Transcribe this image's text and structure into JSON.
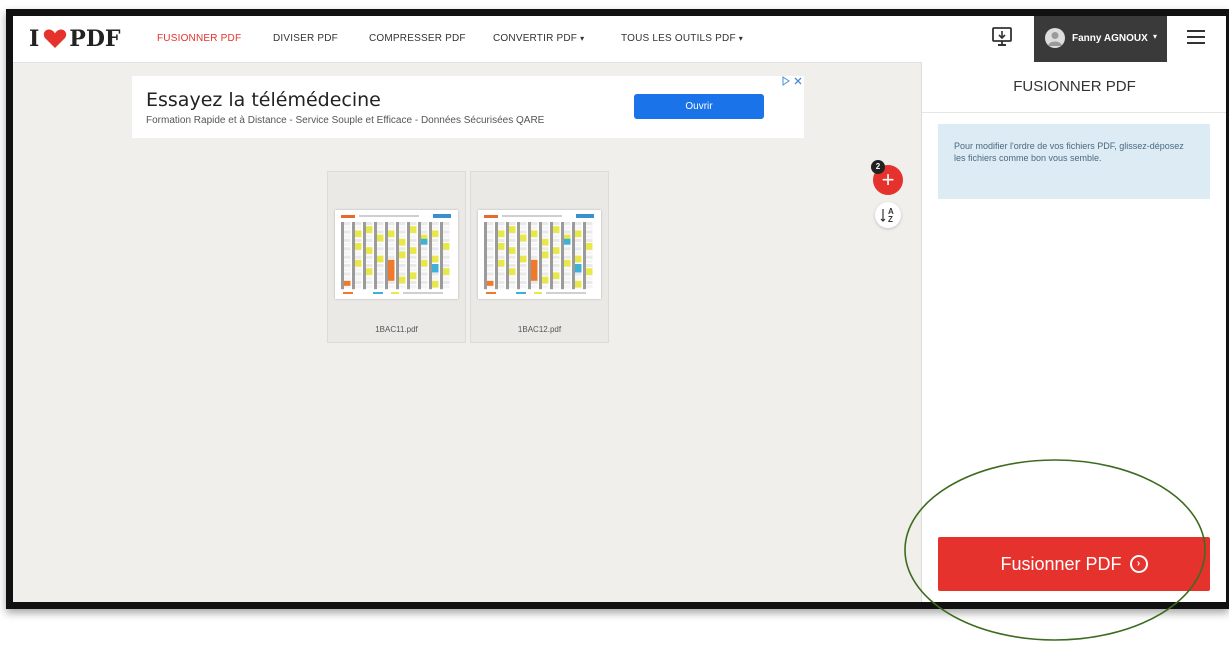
{
  "app": {
    "logo_text_left": "I",
    "logo_text_right": "PDF"
  },
  "header": {
    "nav": [
      {
        "label": "FUSIONNER PDF",
        "active": true
      },
      {
        "label": "DIVISER PDF"
      },
      {
        "label": "COMPRESSER PDF"
      },
      {
        "label": "CONVERTIR PDF",
        "dropdown": true
      },
      {
        "label": "TOUS LES OUTILS PDF",
        "dropdown": true
      }
    ],
    "caret": "▾",
    "user_name": "Fanny AGNOUX"
  },
  "ad": {
    "title": "Essayez la télémédecine",
    "description": "Formation Rapide et à Distance - Service Souple et Efficace - Données Sécurisées QARE",
    "button_label": "Ouvrir"
  },
  "files": [
    {
      "name": "1BAC11.pdf"
    },
    {
      "name": "1BAC12.pdf"
    }
  ],
  "file_count": "2",
  "add_symbol": "+",
  "sort_symbol_top": "A",
  "sort_symbol_bottom": "Z",
  "panel": {
    "title": "FUSIONNER PDF",
    "info": "Pour modifier l'ordre de vos fichiers PDF, glissez-déposez les fichiers comme bon vous semble.",
    "button_label": "Fusionner PDF"
  },
  "colors": {
    "brand_red": "#e5322d",
    "info_blue_bg": "#dcebf4",
    "annotation_green": "#3d6b1f"
  }
}
